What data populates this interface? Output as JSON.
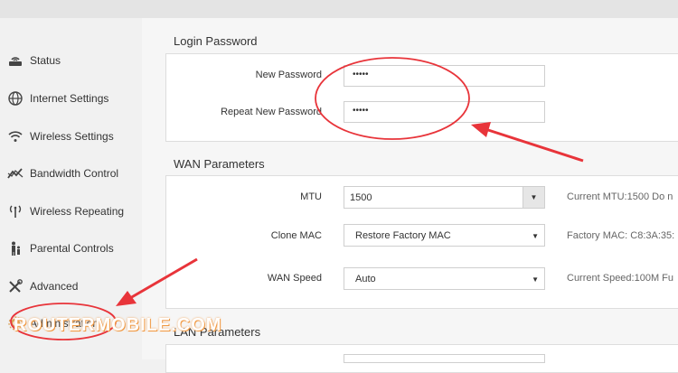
{
  "sidebar": {
    "items": [
      {
        "label": "Status",
        "icon": "router-icon"
      },
      {
        "label": "Internet Settings",
        "icon": "globe-icon"
      },
      {
        "label": "Wireless Settings",
        "icon": "wifi-icon"
      },
      {
        "label": "Bandwidth Control",
        "icon": "chart-line-icon"
      },
      {
        "label": "Wireless Repeating",
        "icon": "signal-icon"
      },
      {
        "label": "Parental Controls",
        "icon": "family-icon"
      },
      {
        "label": "Advanced",
        "icon": "tools-icon"
      },
      {
        "label": "Administration",
        "icon": "gear-icon"
      }
    ]
  },
  "login_password": {
    "title": "Login Password",
    "new_password_label": "New Password",
    "new_password_value": "•••••",
    "repeat_password_label": "Repeat New Password",
    "repeat_password_value": "•••••"
  },
  "wan": {
    "title": "WAN Parameters",
    "mtu_label": "MTU",
    "mtu_value": "1500",
    "mtu_hint": "Current MTU:1500 Do n",
    "clone_mac_label": "Clone MAC",
    "clone_mac_value": "Restore Factory MAC",
    "clone_mac_hint": "Factory MAC: C8:3A:35:",
    "wan_speed_label": "WAN Speed",
    "wan_speed_value": "Auto",
    "wan_speed_hint": "Current Speed:100M Fu"
  },
  "lan": {
    "title": "LAN Parameters"
  },
  "watermark": "ROUTERMOBILE.COM",
  "colors": {
    "annotation": "#e8343a",
    "watermark_outline": "#f0953a"
  }
}
